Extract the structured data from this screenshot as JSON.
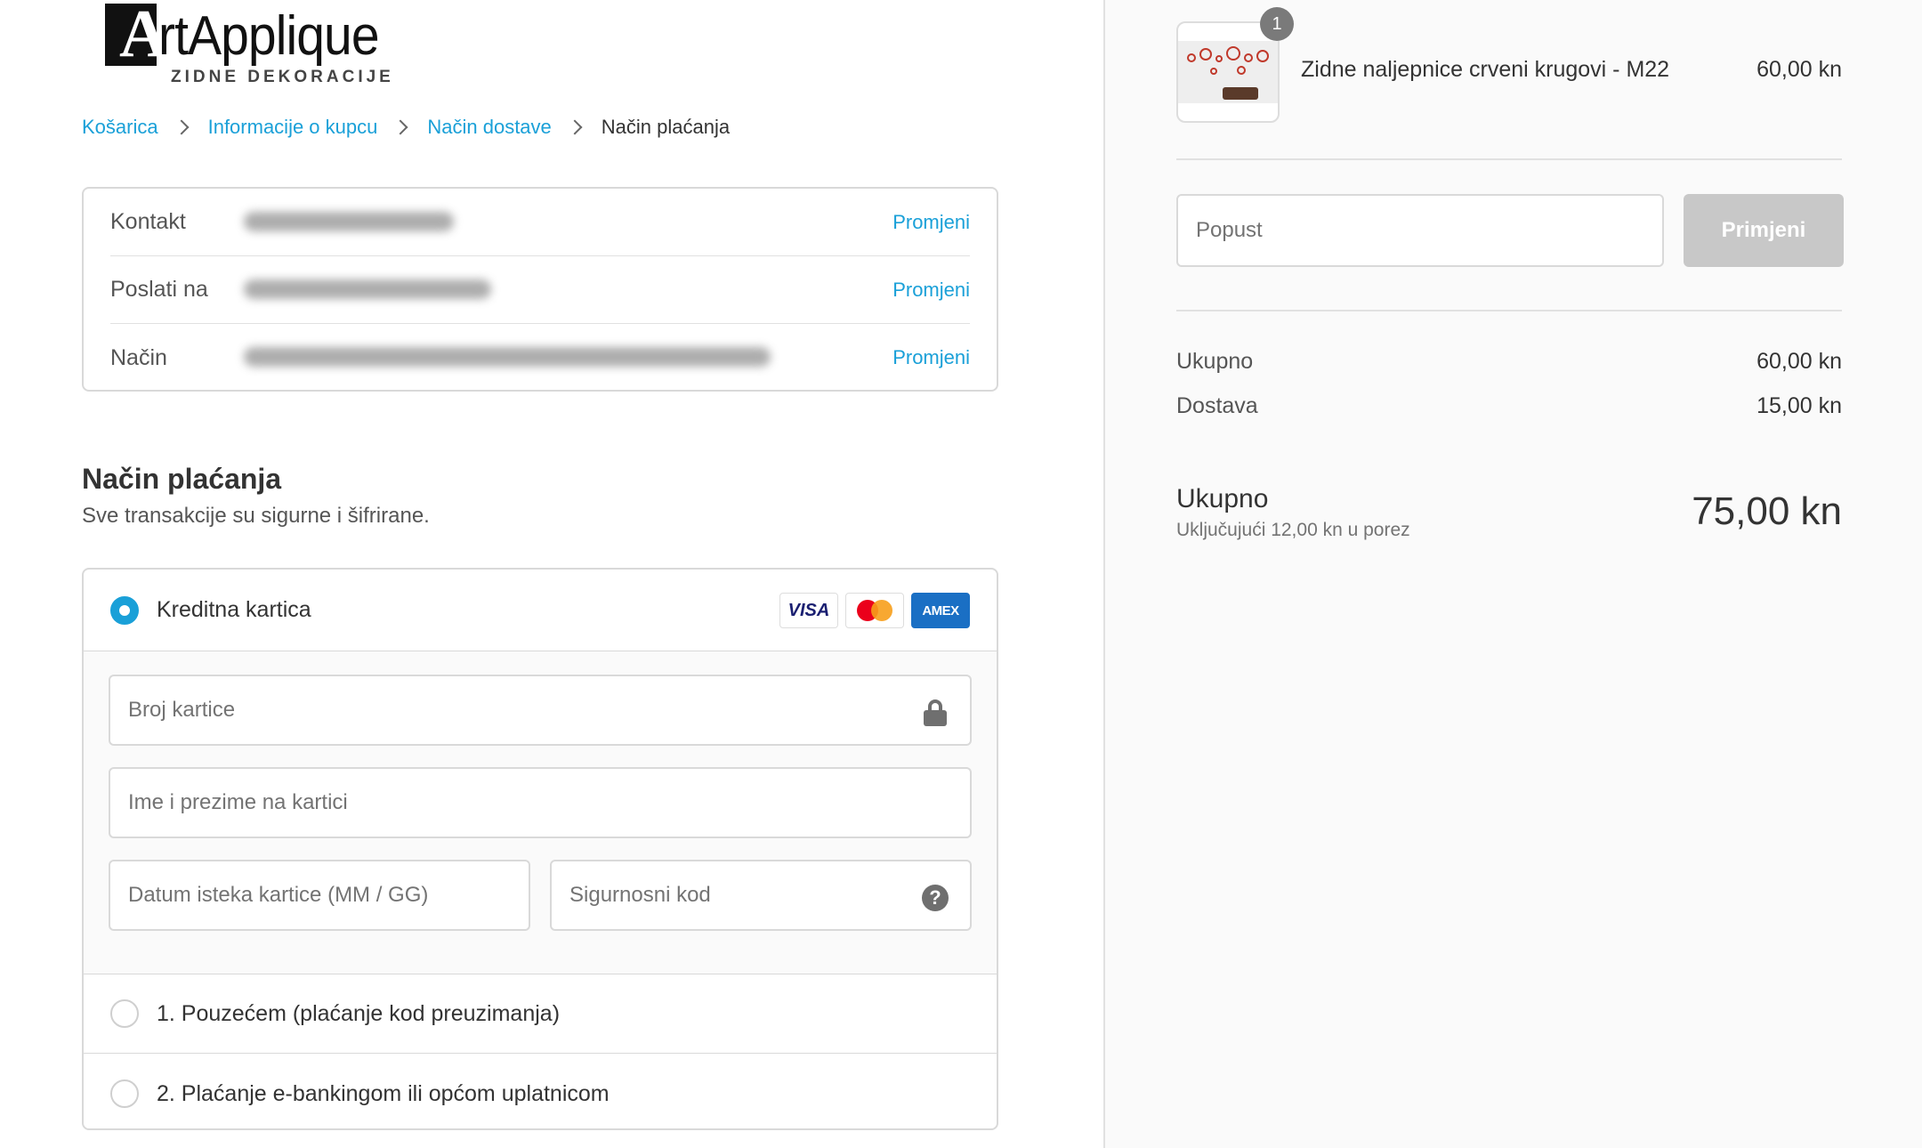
{
  "logo": {
    "letter": "A",
    "word": "rtApplique",
    "tagline": "ZIDNE DEKORACIJE"
  },
  "breadcrumb": {
    "items": [
      "Košarica",
      "Informacije o kupcu",
      "Način dostave"
    ],
    "current": "Način plaćanja"
  },
  "review": {
    "rows": [
      {
        "label": "Kontakt",
        "action": "Promjeni"
      },
      {
        "label": "Poslati na",
        "action": "Promjeni"
      },
      {
        "label": "Način",
        "action": "Promjeni"
      }
    ]
  },
  "payment": {
    "title": "Način plaćanja",
    "subtitle": "Sve transakcije su sigurne i šifrirane.",
    "credit_card": {
      "label": "Kreditna kartica",
      "selected": true,
      "brands": [
        "VISA",
        "MasterCard",
        "AMEX"
      ],
      "fields": {
        "number_placeholder": "Broj kartice",
        "name_placeholder": "Ime i prezime na kartici",
        "expiry_placeholder": "Datum isteka kartice (MM / GG)",
        "cvv_placeholder": "Sigurnosni kod"
      }
    },
    "options": [
      {
        "label": "1. Pouzećem (plaćanje kod preuzimanja)",
        "selected": false
      },
      {
        "label": "2. Plaćanje e-bankingom ili općom uplatnicom",
        "selected": false
      }
    ]
  },
  "summary": {
    "item": {
      "quantity": "1",
      "name": "Zidne naljepnice crveni krugovi - M22",
      "price": "60,00 kn"
    },
    "discount": {
      "placeholder": "Popust",
      "button": "Primjeni"
    },
    "subtotal_label": "Ukupno",
    "subtotal_value": "60,00 kn",
    "shipping_label": "Dostava",
    "shipping_value": "15,00 kn",
    "total_label": "Ukupno",
    "tax_note": "Uključujući 12,00 kn u porez",
    "total_value": "75,00 kn"
  },
  "colors": {
    "accent": "#1aa0d8",
    "button_disabled": "#c8c8c8",
    "sidebar_bg": "#fafafa"
  }
}
